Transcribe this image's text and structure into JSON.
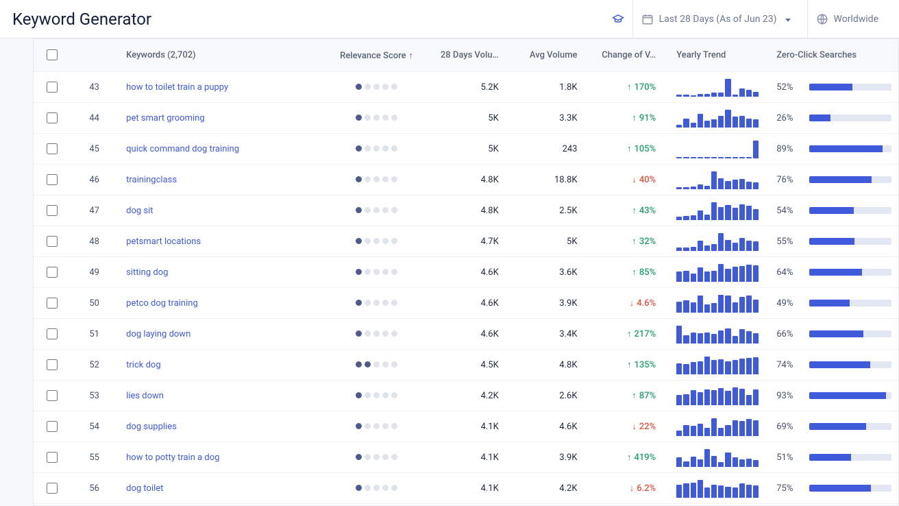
{
  "header": {
    "title": "Keyword Generator",
    "date_range": "Last 28 Days (As of Jun 23)",
    "region": "Worldwide"
  },
  "columns": {
    "keywords": "Keywords (2,702)",
    "relevance": "Relevance Score",
    "vol28": "28 Days Volu…",
    "avg": "Avg Volume",
    "change": "Change of V…",
    "trend": "Yearly Trend",
    "zeroclick": "Zero-Click Searches"
  },
  "rows": [
    {
      "rank": 43,
      "keyword": "how to toilet train a puppy",
      "rel": 1,
      "vol28": "5.2K",
      "avg": "1.8K",
      "change": "170%",
      "dir": "up",
      "zc": 52,
      "spark": [
        10,
        12,
        8,
        14,
        15,
        22,
        20,
        90,
        10,
        40,
        35,
        25
      ]
    },
    {
      "rank": 44,
      "keyword": "pet smart grooming",
      "rel": 1,
      "vol28": "5K",
      "avg": "3.3K",
      "change": "91%",
      "dir": "up",
      "zc": 26,
      "spark": [
        15,
        45,
        25,
        70,
        35,
        40,
        60,
        90,
        55,
        60,
        45,
        40
      ]
    },
    {
      "rank": 45,
      "keyword": "quick command dog training",
      "rel": 1,
      "vol28": "5K",
      "avg": "243",
      "change": "105%",
      "dir": "up",
      "zc": 89,
      "spark": [
        4,
        4,
        4,
        4,
        4,
        4,
        4,
        4,
        4,
        4,
        4,
        95
      ]
    },
    {
      "rank": 46,
      "keyword": "trainingclass",
      "rel": 1,
      "vol28": "4.8K",
      "avg": "18.8K",
      "change": "40%",
      "dir": "down",
      "zc": 76,
      "spark": [
        10,
        12,
        15,
        25,
        20,
        95,
        60,
        45,
        50,
        55,
        40,
        35
      ]
    },
    {
      "rank": 47,
      "keyword": "dog sit",
      "rel": 1,
      "vol28": "4.8K",
      "avg": "2.5K",
      "change": "43%",
      "dir": "up",
      "zc": 54,
      "spark": [
        18,
        22,
        25,
        50,
        30,
        95,
        70,
        80,
        65,
        85,
        75,
        60
      ]
    },
    {
      "rank": 48,
      "keyword": "petsmart locations",
      "rel": 1,
      "vol28": "4.7K",
      "avg": "5K",
      "change": "32%",
      "dir": "up",
      "zc": 55,
      "spark": [
        20,
        18,
        22,
        55,
        30,
        35,
        95,
        60,
        45,
        70,
        55,
        50
      ]
    },
    {
      "rank": 49,
      "keyword": "sitting dog",
      "rel": 1,
      "vol28": "4.6K",
      "avg": "3.6K",
      "change": "85%",
      "dir": "up",
      "zc": 64,
      "spark": [
        55,
        60,
        45,
        75,
        55,
        60,
        95,
        70,
        80,
        85,
        90,
        88
      ]
    },
    {
      "rank": 50,
      "keyword": "petco dog training",
      "rel": 1,
      "vol28": "4.6K",
      "avg": "3.9K",
      "change": "4.6%",
      "dir": "down",
      "zc": 49,
      "spark": [
        60,
        65,
        55,
        90,
        45,
        50,
        95,
        92,
        55,
        85,
        90,
        70
      ]
    },
    {
      "rank": 51,
      "keyword": "dog laying down",
      "rel": 1,
      "vol28": "4.6K",
      "avg": "3.4K",
      "change": "217%",
      "dir": "up",
      "zc": 66,
      "spark": [
        95,
        45,
        60,
        55,
        60,
        50,
        70,
        80,
        40,
        75,
        65,
        55
      ]
    },
    {
      "rank": 52,
      "keyword": "trick dog",
      "rel": 2,
      "vol28": "4.5K",
      "avg": "4.8K",
      "change": "135%",
      "dir": "up",
      "zc": 74,
      "spark": [
        60,
        55,
        65,
        70,
        95,
        75,
        80,
        70,
        75,
        85,
        88,
        90
      ]
    },
    {
      "rank": 53,
      "keyword": "lies down",
      "rel": 1,
      "vol28": "4.2K",
      "avg": "2.6K",
      "change": "87%",
      "dir": "up",
      "zc": 93,
      "spark": [
        55,
        60,
        80,
        70,
        85,
        80,
        90,
        75,
        95,
        88,
        55,
        85
      ]
    },
    {
      "rank": 54,
      "keyword": "dog supplies",
      "rel": 1,
      "vol28": "4.1K",
      "avg": "4.6K",
      "change": "22%",
      "dir": "down",
      "zc": 69,
      "spark": [
        30,
        60,
        55,
        65,
        45,
        95,
        45,
        60,
        85,
        80,
        90,
        85
      ]
    },
    {
      "rank": 55,
      "keyword": "how to potty train a dog",
      "rel": 1,
      "vol28": "4.1K",
      "avg": "3.9K",
      "change": "419%",
      "dir": "up",
      "zc": 51,
      "spark": [
        50,
        30,
        55,
        40,
        95,
        60,
        25,
        75,
        50,
        40,
        45,
        35
      ]
    },
    {
      "rank": 56,
      "keyword": "dog toilet",
      "rel": 1,
      "vol28": "4.1K",
      "avg": "4.2K",
      "change": "6.2%",
      "dir": "down",
      "zc": 75,
      "spark": [
        70,
        75,
        80,
        95,
        55,
        70,
        65,
        60,
        55,
        75,
        70,
        65
      ]
    }
  ]
}
